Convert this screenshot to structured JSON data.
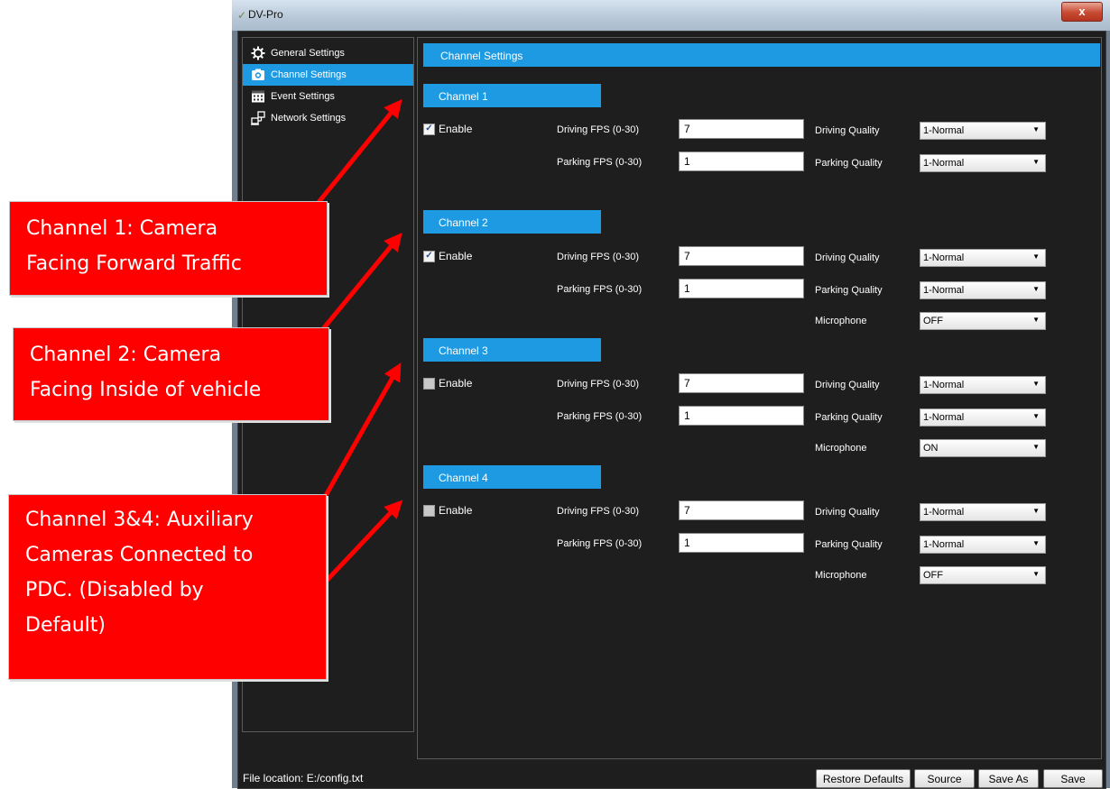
{
  "app": {
    "title": "DV-Pro",
    "close_glyph": "x",
    "icon": "app-logo-icon"
  },
  "sidebar": {
    "items": [
      {
        "label": "General Settings",
        "icon": "gear-icon",
        "active": false
      },
      {
        "label": "Channel Settings",
        "icon": "camera-icon",
        "active": true
      },
      {
        "label": "Event Settings",
        "icon": "calendar-icon",
        "active": false
      },
      {
        "label": "Network Settings",
        "icon": "network-icon",
        "active": false
      }
    ]
  },
  "main": {
    "header": "Channel Settings",
    "channels": [
      {
        "title": "Channel 1",
        "enable_label": "Enable",
        "enabled": true,
        "driving_fps_label": "Driving  FPS (0-30)",
        "driving_fps": "7",
        "parking_fps_label": "Parking FPS (0-30)",
        "parking_fps": "1",
        "driving_quality_label": "Driving Quality",
        "driving_quality": "1-Normal",
        "parking_quality_label": "Parking Quality",
        "parking_quality": "1-Normal"
      },
      {
        "title": "Channel 2",
        "enable_label": "Enable",
        "enabled": true,
        "driving_fps_label": "Driving  FPS (0-30)",
        "driving_fps": "7",
        "parking_fps_label": "Parking FPS (0-30)",
        "parking_fps": "1",
        "driving_quality_label": "Driving Quality",
        "driving_quality": "1-Normal",
        "parking_quality_label": "Parking Quality",
        "parking_quality": "1-Normal",
        "microphone_label": "Microphone",
        "microphone": "OFF"
      },
      {
        "title": "Channel 3",
        "enable_label": "Enable",
        "enabled": false,
        "driving_fps_label": "Driving  FPS (0-30)",
        "driving_fps": "7",
        "parking_fps_label": "Parking FPS (0-30)",
        "parking_fps": "1",
        "driving_quality_label": "Driving Quality",
        "driving_quality": "1-Normal",
        "parking_quality_label": "Parking Quality",
        "parking_quality": "1-Normal",
        "microphone_label": "Microphone",
        "microphone": "ON"
      },
      {
        "title": "Channel 4",
        "enable_label": "Enable",
        "enabled": false,
        "driving_fps_label": "Driving  FPS (0-30)",
        "driving_fps": "7",
        "parking_fps_label": "Parking FPS (0-30)",
        "parking_fps": "1",
        "driving_quality_label": "Driving Quality",
        "driving_quality": "1-Normal",
        "parking_quality_label": "Parking Quality",
        "parking_quality": "1-Normal",
        "microphone_label": "Microphone",
        "microphone": "OFF"
      }
    ]
  },
  "status": {
    "file_location": "File location: E:/config.txt",
    "buttons": {
      "restore": "Restore Defaults",
      "source": "Source",
      "save_as": "Save As",
      "save": "Save"
    }
  },
  "annotations": [
    {
      "lines": [
        "Channel 1: Camera",
        "Facing Forward Traffic"
      ]
    },
    {
      "lines": [
        "Channel 2: Camera",
        "Facing Inside of vehicle"
      ]
    },
    {
      "lines": [
        "Channel 3&4: Auxiliary",
        "Cameras Connected to",
        "PDC. (Disabled by",
        "Default)"
      ]
    }
  ],
  "colors": {
    "accent": "#1e9ae3",
    "background": "#1e1e1e",
    "callout": "#ff0000"
  }
}
